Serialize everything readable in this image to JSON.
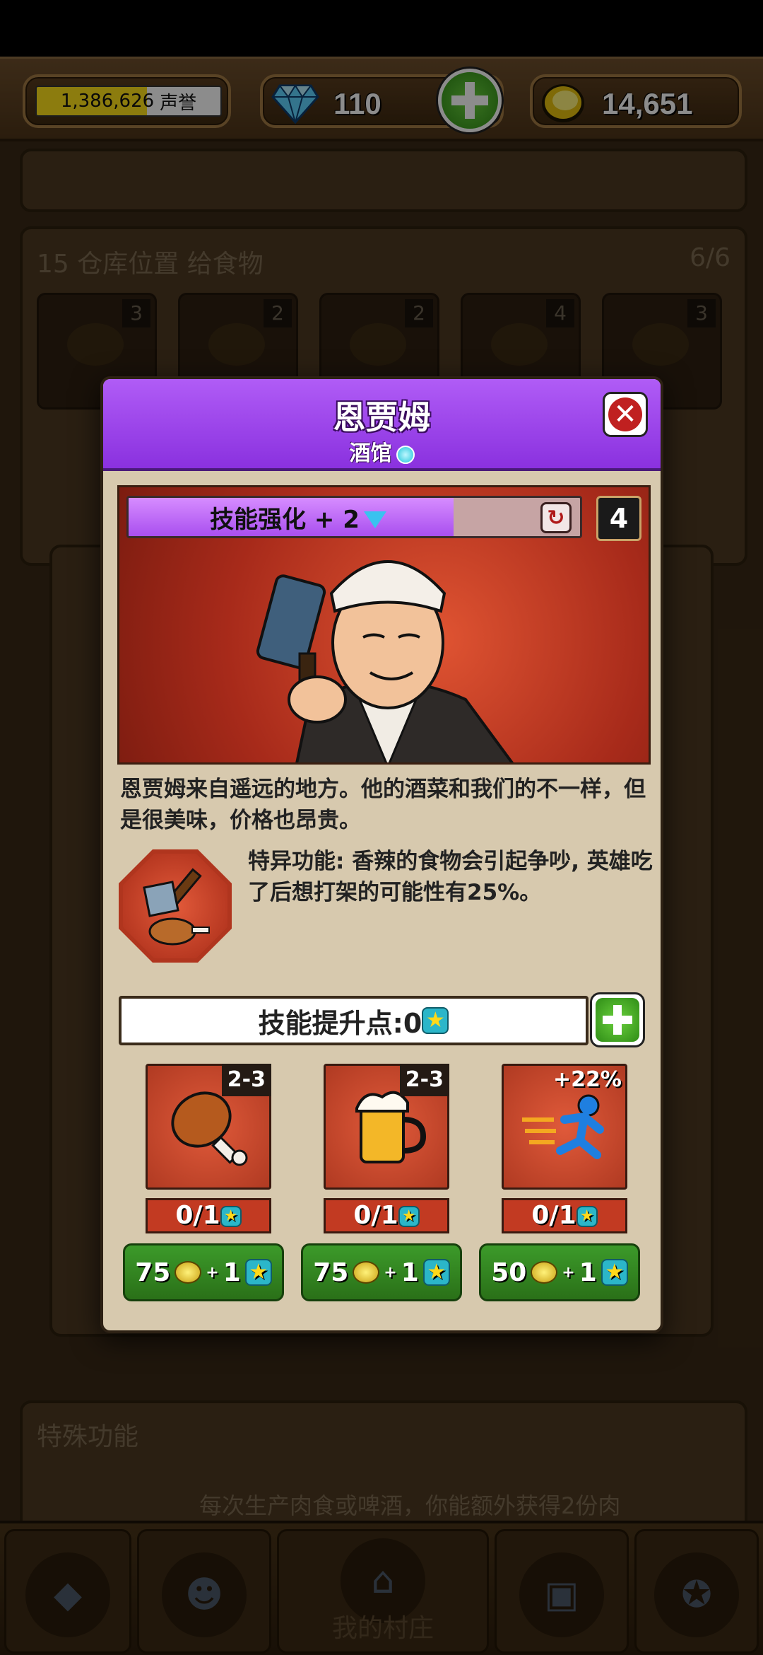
{
  "topbar": {
    "reputation_value": "1,386,626",
    "reputation_label": "声誉",
    "gems": "110",
    "coins": "14,651",
    "gem_icon": "diamond-icon",
    "coin_icon": "coin-icon",
    "add_icon": "plus-icon"
  },
  "background": {
    "storage_title": "15 仓库位置 给食物",
    "storage_count": "6/6",
    "slot_badges": [
      "3",
      "2",
      "2",
      "4",
      "3"
    ],
    "special_title": "特殊功能",
    "special_desc": "每次生产肉食或啤酒，你能额外获得2份肉"
  },
  "bottomnav": {
    "village_label": "我的村庄"
  },
  "modal": {
    "title": "恩贾姆",
    "subtitle": "酒馆",
    "skill_boost": "技能强化 + 2",
    "level": "4",
    "description": "恩贾姆来自遥远的地方。他的酒菜和我们的不一样，但是很美味，价格也昂贵。",
    "ability": "特异功能: 香辣的食物会引起争吵, 英雄吃了后想打架的可能性有25%。",
    "skill_points": "技能提升点:0",
    "upgrades": [
      {
        "tag": "2-3",
        "count": "0/1",
        "cost": "75",
        "plus": "+",
        "star": "1",
        "icon": "drumstick-icon"
      },
      {
        "tag": "2-3",
        "count": "0/1",
        "cost": "75",
        "plus": "+",
        "star": "1",
        "icon": "beer-mug-icon"
      },
      {
        "tag": "+22%",
        "count": "0/1",
        "cost": "50",
        "plus": "+",
        "star": "1",
        "icon": "running-man-icon"
      }
    ]
  },
  "colors": {
    "header_purple": "#9b45ea",
    "panel_tan": "#d7c9ae",
    "button_green": "#2f8d16",
    "accent_red": "#c23a22"
  },
  "skill_bar_fill": 0.72
}
